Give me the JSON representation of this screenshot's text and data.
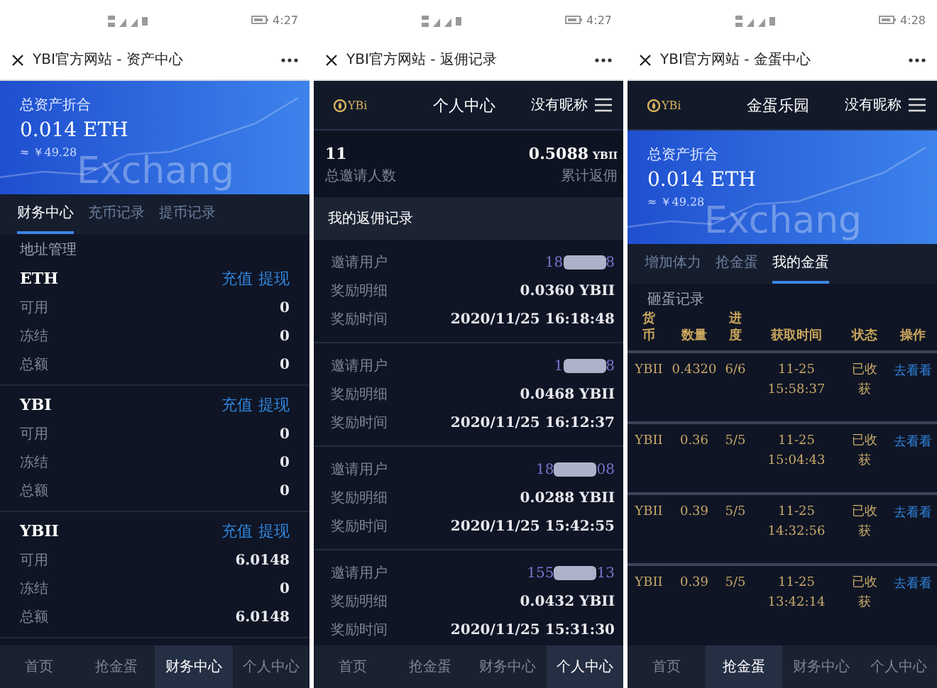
{
  "panels": [
    {
      "kind": "assets",
      "status_time": "4:27",
      "title": "YBI官方网站 - 资产中心",
      "banner": {
        "label": "总资产折合",
        "amount": "0.014 ETH",
        "fiat": "≈ ￥49.28",
        "art_text": "Exchang"
      },
      "tabs": [
        {
          "label": "财务中心",
          "selected": true
        },
        {
          "label": "充币记录",
          "selected": false
        },
        {
          "label": "提币记录",
          "selected": false
        }
      ],
      "sub_link": "地址管理",
      "coins": [
        {
          "name": "ETH",
          "actions": [
            "充值",
            "提现"
          ],
          "rows": [
            {
              "label": "可用",
              "value": "0"
            },
            {
              "label": "冻结",
              "value": "0"
            },
            {
              "label": "总额",
              "value": "0"
            }
          ]
        },
        {
          "name": "YBI",
          "actions": [
            "充值",
            "提现"
          ],
          "rows": [
            {
              "label": "可用",
              "value": "0"
            },
            {
              "label": "冻结",
              "value": "0"
            },
            {
              "label": "总额",
              "value": "0"
            }
          ]
        },
        {
          "name": "YBII",
          "actions": [
            "充值",
            "提现"
          ],
          "rows": [
            {
              "label": "可用",
              "value": "6.0148"
            },
            {
              "label": "冻结",
              "value": "0"
            },
            {
              "label": "总额",
              "value": "6.0148"
            }
          ]
        }
      ],
      "bottom_nav": [
        {
          "label": "首页",
          "selected": false
        },
        {
          "label": "抢金蛋",
          "selected": false
        },
        {
          "label": "财务中心",
          "selected": true
        },
        {
          "label": "个人中心",
          "selected": false
        }
      ]
    },
    {
      "kind": "rebate",
      "status_time": "4:27",
      "title": "YBI官方网站 - 返佣记录",
      "header": {
        "logo": "YBi",
        "heading": "个人中心",
        "nickname": "没有昵称"
      },
      "stats": [
        {
          "value": "11",
          "label": "总邀请人数"
        },
        {
          "value": "0.5088",
          "unit": "YBII",
          "label": "累计返佣"
        }
      ],
      "section_title": "我的返佣记录",
      "records": [
        {
          "rows": [
            {
              "kind": "masked",
              "label": "邀请用户",
              "start": "18",
              "end": "8"
            },
            {
              "kind": "plain",
              "label": "奖励明细",
              "value": "0.0360 YBII"
            },
            {
              "kind": "plain",
              "label": "奖励时间",
              "value": "2020/11/25 16:18:48"
            }
          ]
        },
        {
          "rows": [
            {
              "kind": "masked",
              "label": "邀请用户",
              "start": "1",
              "end": "8"
            },
            {
              "kind": "plain",
              "label": "奖励明细",
              "value": "0.0468 YBII"
            },
            {
              "kind": "plain",
              "label": "奖励时间",
              "value": "2020/11/25 16:12:37"
            }
          ]
        },
        {
          "rows": [
            {
              "kind": "masked",
              "label": "邀请用户",
              "start": "18",
              "end": "08"
            },
            {
              "kind": "plain",
              "label": "奖励明细",
              "value": "0.0288 YBII"
            },
            {
              "kind": "plain",
              "label": "奖励时间",
              "value": "2020/11/25 15:42:55"
            }
          ]
        },
        {
          "rows": [
            {
              "kind": "masked",
              "label": "邀请用户",
              "start": "155",
              "end": "13"
            },
            {
              "kind": "plain",
              "label": "奖励明细",
              "value": "0.0432 YBII"
            },
            {
              "kind": "plain",
              "label": "奖励时间",
              "value": "2020/11/25 15:31:30"
            }
          ]
        }
      ],
      "bottom_nav": [
        {
          "label": "首页",
          "selected": false
        },
        {
          "label": "抢金蛋",
          "selected": false
        },
        {
          "label": "财务中心",
          "selected": false
        },
        {
          "label": "个人中心",
          "selected": true
        }
      ]
    },
    {
      "kind": "eggs",
      "status_time": "4:28",
      "title": "YBI官方网站 - 金蛋中心",
      "header": {
        "logo": "YBi",
        "heading": "金蛋乐园",
        "nickname": "没有昵称"
      },
      "banner": {
        "label": "总资产折合",
        "amount": "0.014 ETH",
        "fiat": "≈ ￥49.28",
        "art_text": "Exchang"
      },
      "tabs": [
        {
          "label": "增加体力",
          "selected": false
        },
        {
          "label": "抢金蛋",
          "selected": false
        },
        {
          "label": "我的金蛋",
          "selected": true
        }
      ],
      "sub_link": "砸蛋记录",
      "table": {
        "columns": [
          "货币",
          "数量",
          "进度",
          "获取时间",
          "状态",
          "操作"
        ],
        "rows": [
          {
            "coin": "YBII",
            "amount": "0.4320",
            "progress": "6/6",
            "time": "11-25 15:58:37",
            "status": "已收获",
            "action": "去看看"
          },
          {
            "coin": "YBII",
            "amount": "0.36",
            "progress": "5/5",
            "time": "11-25 15:04:43",
            "status": "已收获",
            "action": "去看看"
          },
          {
            "coin": "YBII",
            "amount": "0.39",
            "progress": "5/5",
            "time": "11-25 14:32:56",
            "status": "已收获",
            "action": "去看看"
          },
          {
            "coin": "YBII",
            "amount": "0.39",
            "progress": "5/5",
            "time": "11-25 13:42:14",
            "status": "已收获",
            "action": "去看看"
          }
        ]
      },
      "bottom_nav": [
        {
          "label": "首页",
          "selected": false
        },
        {
          "label": "抢金蛋",
          "selected": true
        },
        {
          "label": "财务中心",
          "selected": false
        },
        {
          "label": "个人中心",
          "selected": false
        }
      ]
    }
  ]
}
